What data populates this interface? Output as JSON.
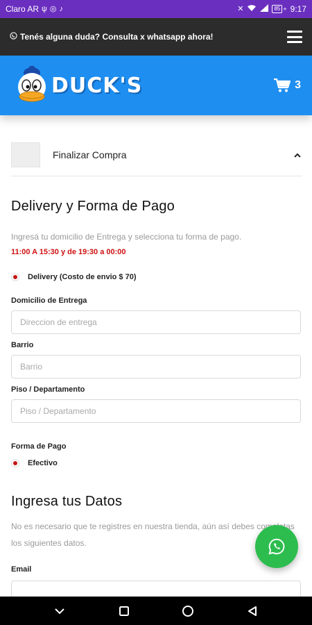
{
  "status_bar": {
    "carrier": "Claro AR",
    "battery": "85",
    "time": "9:17"
  },
  "topbar": {
    "promo_text": "Tenés alguna duda? Consulta x whatsapp ahora!"
  },
  "brand": {
    "logo_text": "DUCK'S",
    "cart_count": "3"
  },
  "checkout": {
    "title": "Finalizar Compra"
  },
  "delivery": {
    "heading": "Delivery y Forma de Pago",
    "instructions": "Ingresá tu domicilio de Entrega y selecciona tu forma de pago.",
    "hours": "11:00 A 15:30 y de 19:30 a 00:00",
    "option_label": "Delivery (Costo de envio $ 70)",
    "address_label": "Domicilio de Entrega",
    "address_placeholder": "Direccion de entrega",
    "barrio_label": "Barrio",
    "barrio_placeholder": "Barrio",
    "piso_label": "Piso / Departamento",
    "piso_placeholder": "Piso / Departamento",
    "payment_label": "Forma de Pago",
    "payment_option": "Efectivo"
  },
  "datos": {
    "heading": "Ingresa tus Datos",
    "description": "No es necesario que te registres en nuestra tienda, aún así debes completas los siguientes datos.",
    "email_label": "Email",
    "email_value": ""
  },
  "colors": {
    "statusbar": "#6a2fbf",
    "topbar": "#2c2c2c",
    "brand_blue": "#1e8ef0",
    "hours_red": "#d01010",
    "whatsapp_green": "#2dbd4e"
  }
}
